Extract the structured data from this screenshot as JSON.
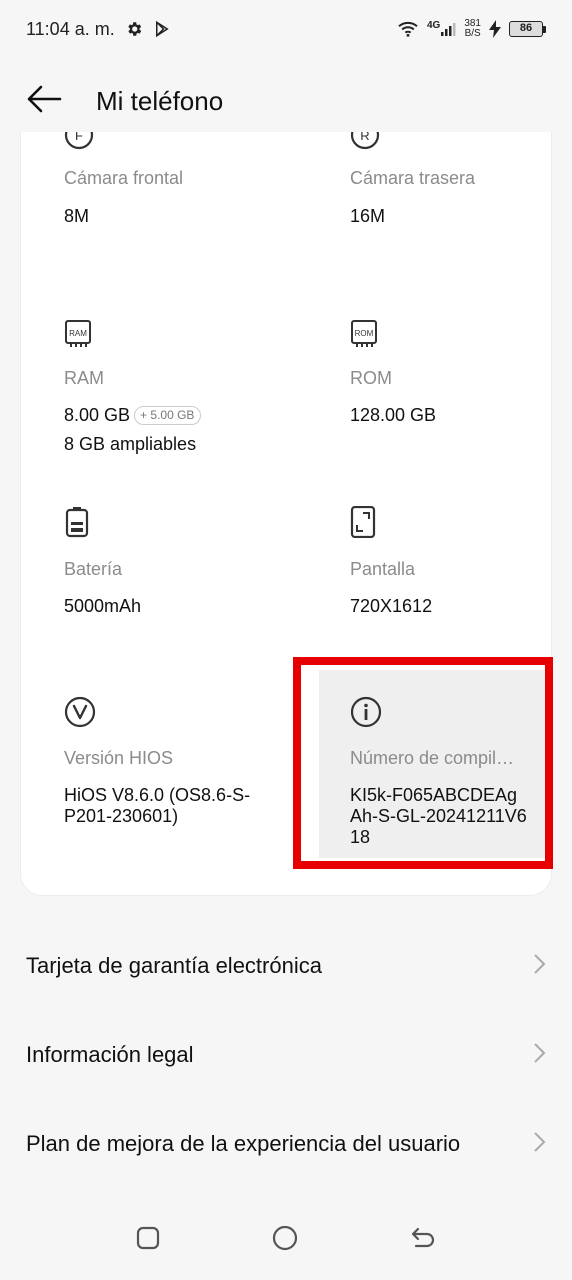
{
  "status_bar": {
    "time": "11:04 a. m.",
    "network": "4G",
    "speed_value": "381",
    "speed_unit": "B/S",
    "battery": "86",
    "icons": [
      "settings-icon",
      "play-store-icon",
      "wifi-icon",
      "signal-icon",
      "charging-icon",
      "battery-icon"
    ]
  },
  "header": {
    "title": "Mi teléfono",
    "back_icon": "arrow-left-icon"
  },
  "specs": {
    "front_camera": {
      "label": "Cámara frontal",
      "value": "8M",
      "icon": "front-camera-icon"
    },
    "rear_camera": {
      "label": "Cámara trasera",
      "value": "16M",
      "icon": "rear-camera-icon"
    },
    "ram": {
      "label": "RAM",
      "value": "8.00 GB",
      "extra": "+ 5.00 GB",
      "note": "8 GB ampliables",
      "icon": "ram-chip-icon",
      "icon_text": "RAM"
    },
    "rom": {
      "label": "ROM",
      "value": "128.00 GB",
      "icon": "rom-chip-icon",
      "icon_text": "ROM"
    },
    "battery": {
      "label": "Batería",
      "value": "5000mAh",
      "icon": "battery-icon"
    },
    "screen": {
      "label": "Pantalla",
      "value": "720X1612",
      "icon": "screen-icon"
    },
    "hios_version": {
      "label": "Versión HIOS",
      "value": "HiOS V8.6.0 (OS8.6-S-P201-230601)",
      "icon": "version-icon"
    },
    "build_number": {
      "label": "Número de compil…",
      "value": "KI5k-F065ABCDEAgAh-S-GL-20241211V618",
      "icon": "info-icon"
    }
  },
  "list": [
    {
      "label": "Tarjeta de garantía electrónica"
    },
    {
      "label": "Información legal"
    },
    {
      "label": "Plan de mejora de la experiencia del usuario"
    }
  ],
  "nav": [
    "recents-button",
    "home-button",
    "back-button"
  ],
  "colors": {
    "highlight_border": "#e60000",
    "background": "#f6f6f7",
    "card": "#ffffff",
    "label_gray": "#8b8b8e"
  }
}
